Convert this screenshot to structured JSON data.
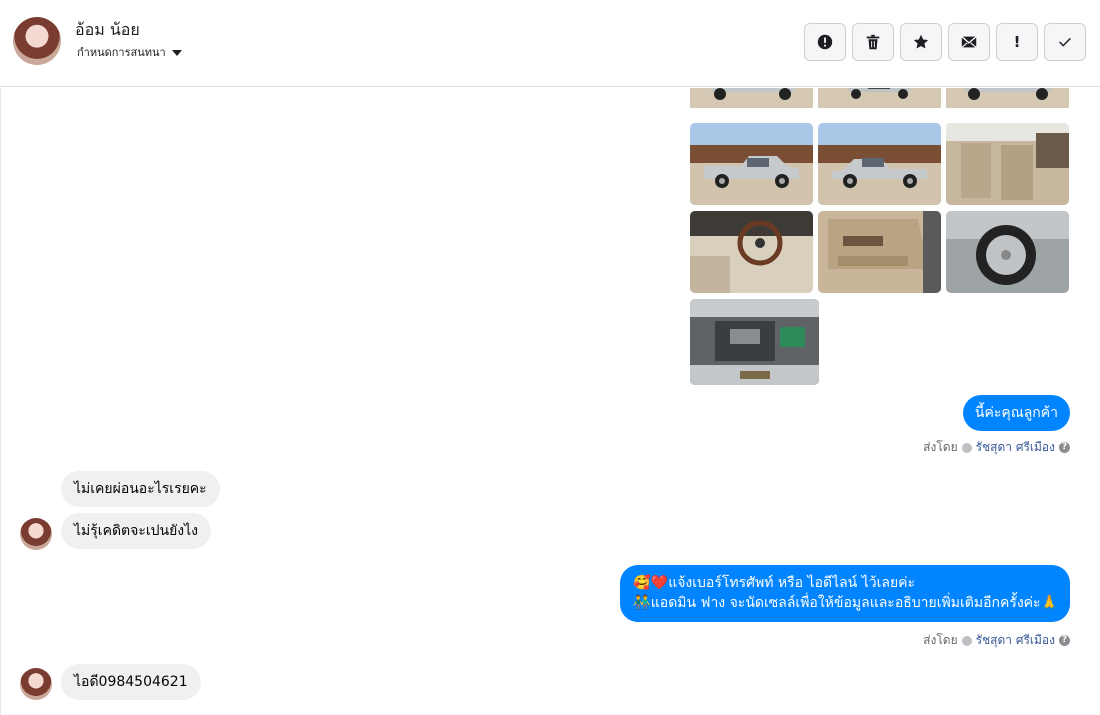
{
  "header": {
    "contact_name": "อ้อม น้อย",
    "assign_label": "กำหนดการสนทนา",
    "tools": [
      {
        "icon": "alert-circle-icon",
        "label": "Mark as spam"
      },
      {
        "icon": "trash-icon",
        "label": "Delete"
      },
      {
        "icon": "star-icon",
        "label": "Star"
      },
      {
        "icon": "envelope-icon",
        "label": "Mark as unread"
      },
      {
        "icon": "exclamation-icon",
        "label": "Follow up"
      },
      {
        "icon": "check-icon",
        "label": "Mark as done"
      }
    ]
  },
  "messages": {
    "out_1": "นี้ค่ะคุณลูกค้า",
    "sent_by_prefix": "ส่งโดย",
    "sent_by_name": "รัชสุดา ศรีเมือง",
    "in_1": "ไม่เคยผ่อนอะไรเรยคะ",
    "in_2": "ไม่รุ้เคดิตจะเปนยังไง",
    "out_2_line1": "🥰❤️แจ้งเบอร์โทรศัพท์ หรือ ไอดีไลน์  ไว้เลยค่ะ",
    "out_2_line2": "👬แอดมิน ฟาง จะนัดเซลล์เพื่อให้ข้อมูลและอธิบายเพิ่มเติมอีกครั้งค่ะ🙏",
    "in_3": "ไอดี0984504621"
  },
  "photos": [
    "car-front-left",
    "car-front",
    "car-front-right",
    "car-side-left",
    "car-side-right",
    "car-seats",
    "car-steering-wheel",
    "car-door-panel",
    "car-wheel",
    "car-engine"
  ]
}
